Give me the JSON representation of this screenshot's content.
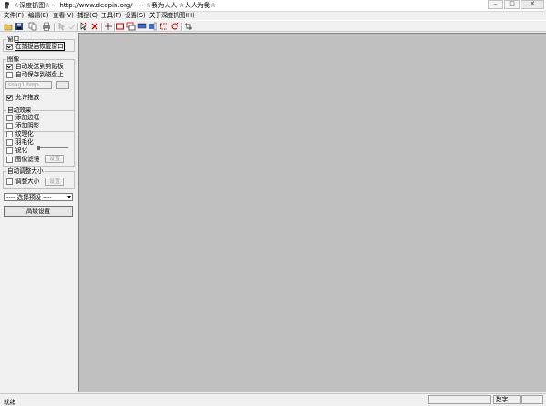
{
  "window": {
    "title": "☆深度抓图☆--- http://www.deepin.org/ ---- ☆我为人人 ☆人人为我☆",
    "minimize_glyph": "–",
    "maximize_glyph": "□",
    "close_glyph": "✕"
  },
  "menu": [
    "文件(F)",
    "编辑(E)",
    "查看(V)",
    "捕捉(C)",
    "工具(T)",
    "设置(S)",
    "关于深度抓图(H)"
  ],
  "toolbar": {
    "icons": [
      "open-folder-icon",
      "save-icon",
      "copy-icon",
      "print-icon",
      "pointer-icon",
      "pointer-disabled-icon",
      "capture-cursor-icon",
      "delete-icon",
      "capture-region-icon",
      "capture-rect-icon",
      "capture-window-icon",
      "capture-fullscreen-icon",
      "capture-scroll-icon",
      "capture-object-icon",
      "record-icon",
      "crop-icon"
    ]
  },
  "panel": {
    "window_group": {
      "title": "窗口",
      "restore_label": "在捕捉后恢复窗口",
      "restore_checked": true
    },
    "image_group": {
      "title": "图像",
      "clipboard_label": "自动发送到剪贴板",
      "clipboard_checked": true,
      "autosave_label": "自动保存到磁盘上",
      "autosave_checked": false,
      "path_value": "snag1.bmp",
      "drag_label": "允许拖放",
      "drag_checked": true
    },
    "effects_group": {
      "title": "自动效果",
      "items": [
        {
          "label": "添加边框",
          "checked": false
        },
        {
          "label": "添加阴影",
          "checked": false
        },
        {
          "label": "纹理化",
          "checked": false
        },
        {
          "label": "羽毛化",
          "checked": false
        },
        {
          "label": "锐化",
          "checked": false
        },
        {
          "label": "图像滤镜",
          "checked": false
        }
      ],
      "settings_button": "设置"
    },
    "resize_group": {
      "title": "自动调整大小",
      "resize_label": "调整大小",
      "resize_checked": false,
      "settings_button": "设置"
    },
    "preset_select": "---- 选择预设 ----",
    "advanced_button": "高级设置"
  },
  "statusbar": {
    "left": "就绪",
    "panel_text": "数字"
  }
}
